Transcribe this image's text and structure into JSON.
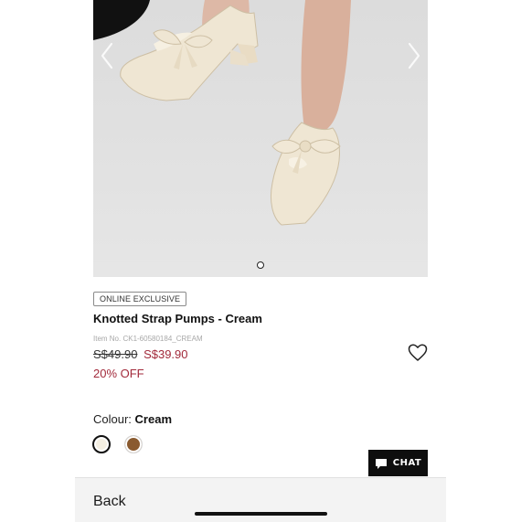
{
  "product": {
    "badge": "ONLINE EXCLUSIVE",
    "name": "Knotted Strap Pumps - Cream",
    "item_no": "Item No. CK1-60580184_CREAM",
    "original_price": "S$49.90",
    "sale_price": "S$39.90",
    "discount": "20% OFF"
  },
  "gallery": {
    "image_count": 1,
    "active_index": 0
  },
  "colour": {
    "label": "Colour:",
    "selected": "Cream",
    "options": [
      {
        "name": "Cream",
        "hex": "#f4efe2"
      },
      {
        "name": "Brown",
        "hex": "#8a5a2f"
      }
    ]
  },
  "chat": {
    "label": "CHAT"
  },
  "bottom_bar": {
    "back_label": "Back"
  },
  "colors": {
    "sale": "#a22a3b",
    "chat_bg": "#0e0e0e",
    "shoe": "#efe6d3"
  }
}
